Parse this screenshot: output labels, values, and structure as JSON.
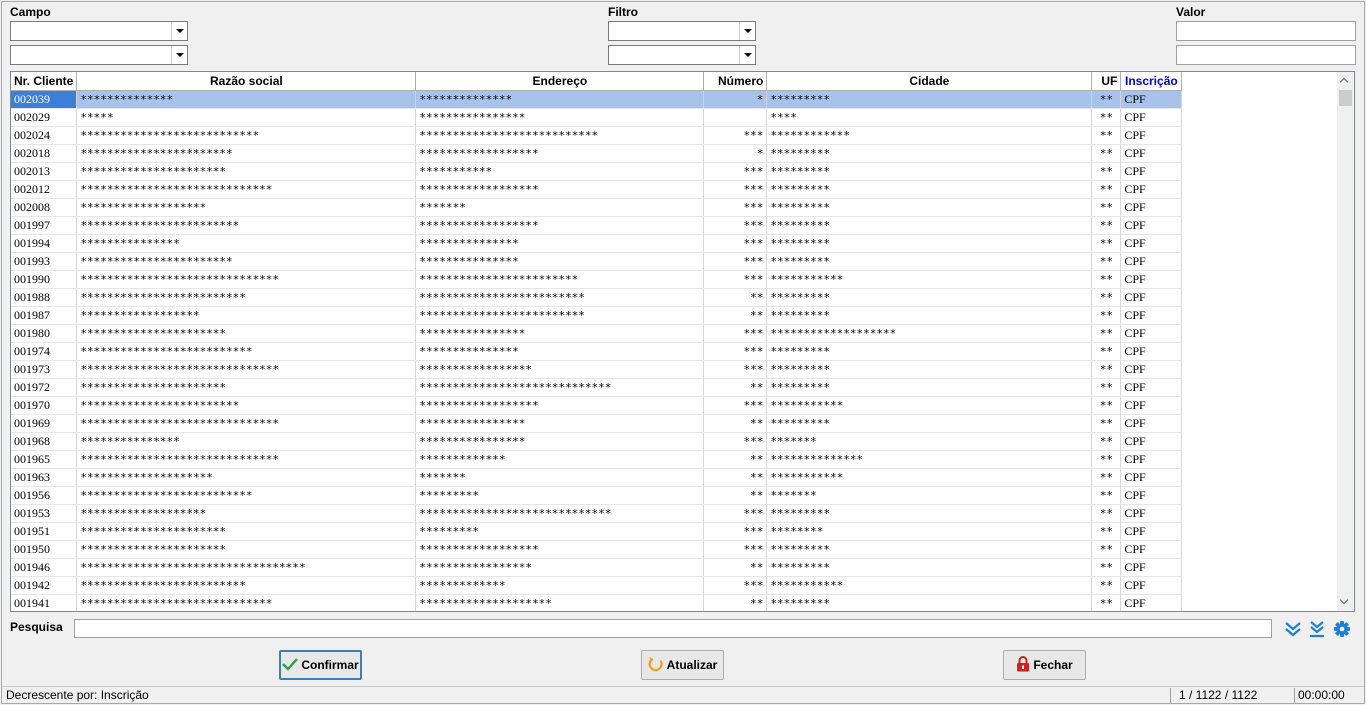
{
  "filters": {
    "campo_label": "Campo",
    "filtro_label": "Filtro",
    "valor_label": "Valor"
  },
  "grid": {
    "columns": [
      "Nr. Cliente",
      "Razão social",
      "Endereço",
      "Número",
      "Cidade",
      "UF",
      "Inscrição"
    ],
    "rows": [
      [
        "002039",
        "**************",
        "**************",
        "*",
        "*********",
        "**",
        "CPF"
      ],
      [
        "002029",
        "*****",
        "****************",
        "",
        "****",
        "**",
        "CPF"
      ],
      [
        "002024",
        "***************************",
        "***************************",
        "***",
        "************",
        "**",
        "CPF"
      ],
      [
        "002018",
        "***********************",
        "******************",
        "*",
        "*********",
        "**",
        "CPF"
      ],
      [
        "002013",
        "**********************",
        "***********",
        "***",
        "*********",
        "**",
        "CPF"
      ],
      [
        "002012",
        "*****************************",
        "******************",
        "***",
        "*********",
        "**",
        "CPF"
      ],
      [
        "002008",
        "*******************",
        "*******",
        "***",
        "*********",
        "**",
        "CPF"
      ],
      [
        "001997",
        "************************",
        "******************",
        "***",
        "*********",
        "**",
        "CPF"
      ],
      [
        "001994",
        "***************",
        "***************",
        "***",
        "*********",
        "**",
        "CPF"
      ],
      [
        "001993",
        "***********************",
        "***************",
        "***",
        "*********",
        "**",
        "CPF"
      ],
      [
        "001990",
        "******************************",
        "************************",
        "***",
        "***********",
        "**",
        "CPF"
      ],
      [
        "001988",
        "*************************",
        "*************************",
        "**",
        "*********",
        "**",
        "CPF"
      ],
      [
        "001987",
        "******************",
        "*************************",
        "**",
        "*********",
        "**",
        "CPF"
      ],
      [
        "001980",
        "**********************",
        "****************",
        "***",
        "*******************",
        "**",
        "CPF"
      ],
      [
        "001974",
        "**************************",
        "***************",
        "***",
        "*********",
        "**",
        "CPF"
      ],
      [
        "001973",
        "******************************",
        "*****************",
        "***",
        "*********",
        "**",
        "CPF"
      ],
      [
        "001972",
        "**********************",
        "*****************************",
        "**",
        "*********",
        "**",
        "CPF"
      ],
      [
        "001970",
        "************************",
        "******************",
        "***",
        "***********",
        "**",
        "CPF"
      ],
      [
        "001969",
        "******************************",
        "****************",
        "**",
        "*********",
        "**",
        "CPF"
      ],
      [
        "001968",
        "***************",
        "****************",
        "***",
        "*******",
        "**",
        "CPF"
      ],
      [
        "001965",
        "******************************",
        "*************",
        "**",
        "**************",
        "**",
        "CPF"
      ],
      [
        "001963",
        "********************",
        "*******",
        "**",
        "***********",
        "**",
        "CPF"
      ],
      [
        "001956",
        "**************************",
        "*********",
        "**",
        "*******",
        "**",
        "CPF"
      ],
      [
        "001953",
        "*******************",
        "*****************************",
        "***",
        "*********",
        "**",
        "CPF"
      ],
      [
        "001951",
        "**********************",
        "*********",
        "***",
        "********",
        "**",
        "CPF"
      ],
      [
        "001950",
        "**********************",
        "******************",
        "***",
        "*********",
        "**",
        "CPF"
      ],
      [
        "001946",
        "**********************************",
        "*****************",
        "**",
        "*********",
        "**",
        "CPF"
      ],
      [
        "001942",
        "*************************",
        "*************",
        "***",
        "***********",
        "**",
        "CPF"
      ],
      [
        "001941",
        "*****************************",
        "********************",
        "**",
        "*********",
        "**",
        "CPF"
      ]
    ]
  },
  "search": {
    "label": "Pesquisa",
    "value": ""
  },
  "buttons": {
    "confirm": "Confirmar",
    "refresh": "Atualizar",
    "close": "Fechar"
  },
  "status": {
    "sort_text": "Decrescente por:  Inscrição",
    "records": "1 / 1122 / 1122",
    "time": "00:00:00"
  },
  "colors": {
    "selection": "#a7c3ec",
    "selection_key": "#3b7fd9",
    "accent_blue": "#1f7fd6",
    "confirm_green": "#2ea043",
    "refresh_orange": "#f0a020",
    "close_red": "#d42020"
  }
}
